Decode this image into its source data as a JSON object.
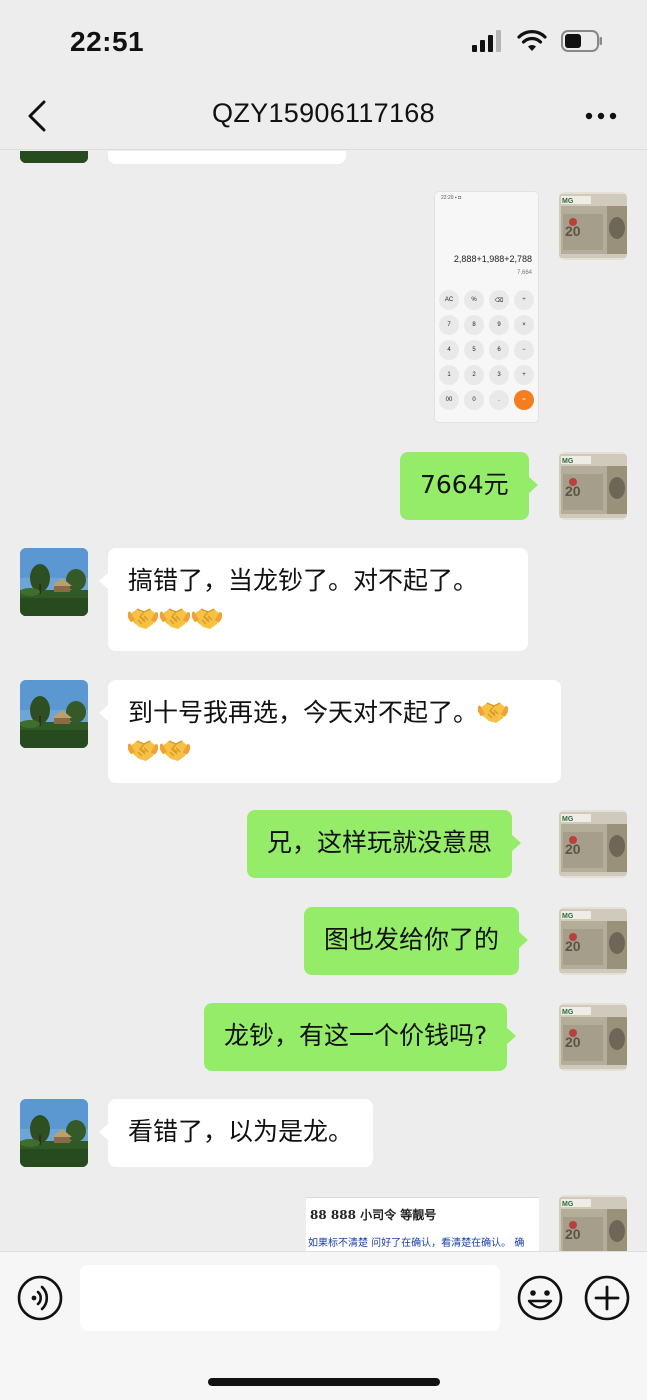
{
  "status_bar": {
    "time": "22:51",
    "icons": [
      "signal-icon",
      "wifi-icon",
      "battery-icon"
    ]
  },
  "nav": {
    "title": "QZY15906117168",
    "back_icon": "chevron-left-icon",
    "more_icon": "more-icon"
  },
  "messages": [
    {
      "side": "out",
      "type": "image",
      "content": "calculator-screenshot"
    },
    {
      "side": "out",
      "type": "text",
      "text": "7664元"
    },
    {
      "side": "in",
      "type": "text",
      "text": "搞错了，当龙钞了。对不起了。",
      "emoji": [
        "handshake",
        "handshake",
        "handshake"
      ]
    },
    {
      "side": "in",
      "type": "text",
      "text": "到十号我再选，今天对不起了。",
      "emoji": [
        "handshake",
        "handshake",
        "handshake"
      ]
    },
    {
      "side": "out",
      "type": "text",
      "text": "兄，这样玩就没意思"
    },
    {
      "side": "out",
      "type": "text",
      "text": "图也发给你了的"
    },
    {
      "side": "out",
      "type": "text",
      "text": "龙钞，有这一个价钱吗?"
    },
    {
      "side": "in",
      "type": "text",
      "text": "看错了，以为是龙。"
    },
    {
      "side": "out",
      "type": "image",
      "content": "document-screenshot"
    }
  ],
  "calculator": {
    "status": "22:20 ▪ ◘",
    "expression": "2,888+1,988+2,788",
    "result": "7,664",
    "keys": [
      "AC",
      "%",
      "⌫",
      "÷",
      "7",
      "8",
      "9",
      "×",
      "4",
      "5",
      "6",
      "−",
      "1",
      "2",
      "3",
      "+",
      "00",
      "0",
      ".",
      "="
    ]
  },
  "document": {
    "line1": "88 888 小司令 等靓号",
    "line2": "如果标不清楚  问好了在确认，看清楚在确认。 确"
  },
  "input_bar": {
    "voice_icon": "voice-icon",
    "emoji_icon": "emoji-icon",
    "add_icon": "plus-icon"
  },
  "colors": {
    "background": "#ededed",
    "outgoing_bubble": "#95ec69",
    "incoming_bubble": "#ffffff",
    "calc_equal": "#f57c1f"
  }
}
